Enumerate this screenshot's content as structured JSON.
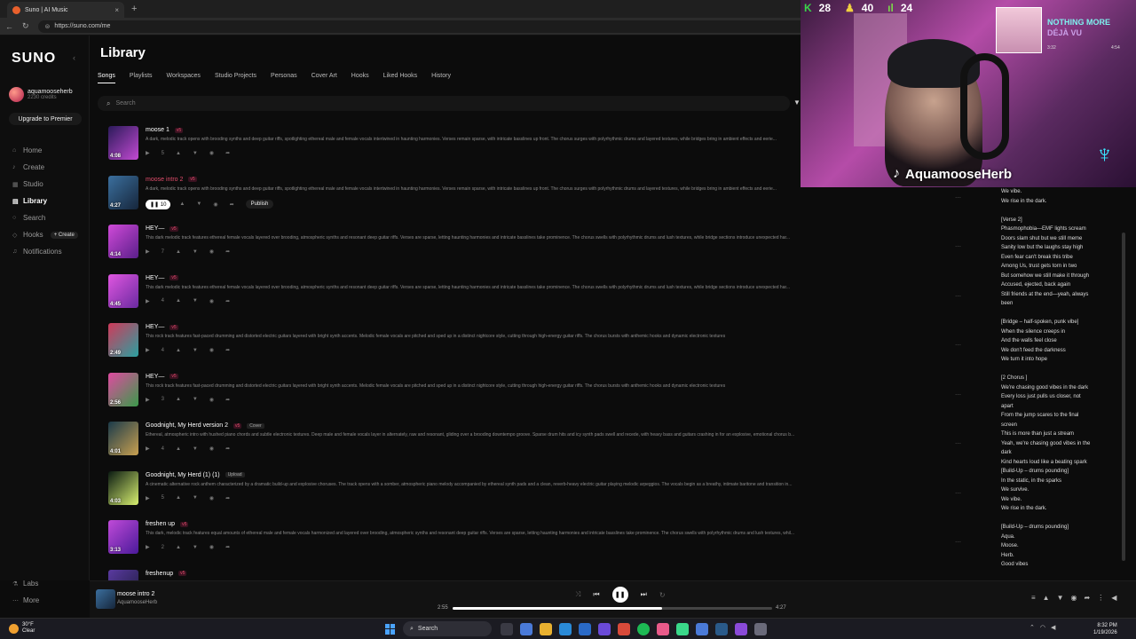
{
  "browser": {
    "tab_title": "Suno | AI Music",
    "tab_close": "×",
    "new_tab": "+",
    "url": "https://suno.com/me"
  },
  "sidebar": {
    "logo": "SUNO",
    "user_name": "aquamooseherb",
    "credits": "2230 credits",
    "upgrade_label": "Upgrade to Premier",
    "items": [
      {
        "label": "Home",
        "icon": "home-icon",
        "glyph": "⌂"
      },
      {
        "label": "Create",
        "icon": "create-icon",
        "glyph": "♪"
      },
      {
        "label": "Studio",
        "icon": "studio-icon",
        "glyph": "▦"
      },
      {
        "label": "Library",
        "icon": "library-icon",
        "glyph": "▤"
      },
      {
        "label": "Search",
        "icon": "search-icon",
        "glyph": "○"
      },
      {
        "label": "Hooks",
        "icon": "hooks-icon",
        "glyph": "◇"
      },
      {
        "label": "Notifications",
        "icon": "bell-icon",
        "glyph": "♫"
      }
    ],
    "hooks_create": "+ Create",
    "labs": "Labs",
    "more": "More"
  },
  "main": {
    "title": "Library",
    "tabs": [
      "Songs",
      "Playlists",
      "Workspaces",
      "Studio Projects",
      "Personas",
      "Cover Art",
      "Hooks",
      "Liked Hooks",
      "History"
    ],
    "search_placeholder": "Search"
  },
  "songs": [
    {
      "title": "moose 1",
      "version": "v5",
      "duration": "4:08",
      "plays": "5",
      "desc": "A dark, melodic track opens with brooding synths and deep guitar riffs, spotlighting ethereal male and female vocals intertwined in haunting harmonies. Verses remain sparse, with intricate basslines up front. The chorus surges with polyrhythmic drums and layered textures, while bridges bring in ambient effects and eerie...",
      "colors": [
        "#2b1a5a",
        "#c24ad2"
      ]
    },
    {
      "title": "moose intro 2",
      "version": "v5",
      "duration": "4:27",
      "plays": "10",
      "desc": "A dark, melodic track opens with brooding synths and deep guitar riffs, spotlighting ethereal male and female vocals intertwined in haunting harmonies. Verses remain sparse, with intricate basslines up front. The chorus surges with polyrhythmic drums and layered textures, while bridges bring in ambient effects and eerie...",
      "colors": [
        "#3b6f9e",
        "#16263b"
      ],
      "playing": true,
      "publish": "Publish"
    },
    {
      "title": "HEY—",
      "version": "v5",
      "duration": "4:14",
      "plays": "7",
      "desc": "This dark melodic track features ethereal female vocals layered over brooding, atmospheric synths and resonant deep guitar riffs. Verses are sparse, letting haunting harmonies and intricate basslines take prominence. The chorus swells with polyrhythmic drums and lush textures, while bridge sections introduce unexpected har...",
      "colors": [
        "#d04ad8",
        "#5a1f8a"
      ]
    },
    {
      "title": "HEY—",
      "version": "v5",
      "duration": "4:45",
      "plays": "4",
      "desc": "This dark melodic track features ethereal female vocals layered over brooding, atmospheric synths and resonant deep guitar riffs. Verses are sparse, letting haunting harmonies and intricate basslines take prominence. The chorus swells with polyrhythmic drums and lush textures, while bridge sections introduce unexpected har...",
      "colors": [
        "#e056e0",
        "#6a2aa0"
      ]
    },
    {
      "title": "HEY—",
      "version": "v5",
      "duration": "2:49",
      "plays": "4",
      "desc": "This rock track features fast-paced drumming and distorted electric guitars layered with bright synth accents. Melodic female vocals are pitched and sped up in a distinct nightcore style, cutting through high-energy guitar riffs. The chorus bursts with anthemic hooks and dynamic electronic textures",
      "colors": [
        "#d03a5a",
        "#2aa0a0"
      ]
    },
    {
      "title": "HEY—",
      "version": "v5",
      "duration": "2:56",
      "plays": "3",
      "desc": "This rock track features fast-paced drumming and distorted electric guitars layered with bright synth accents. Melodic female vocals are pitched and sped up in a distinct nightcore style, cutting through high-energy guitar riffs. The chorus bursts with anthemic hooks and dynamic electronic textures",
      "colors": [
        "#e04aa0",
        "#3a9a4a"
      ]
    },
    {
      "title": "Goodnight, My Herd version 2",
      "version": "v5",
      "tag": "Cover",
      "duration": "4:01",
      "plays": "4",
      "desc": "Ethereal, atmospheric intro with hushed piano chords and subtle electronic textures. Deep male and female vocals layer in alternately, raw and resonant, gliding over a brooding downtempo groove. Sparse drum hits and icy synth pads swell and recede, with heavy bass and guitars crashing in for an explosive, emotional chorus b...",
      "colors": [
        "#1a3a4a",
        "#c8a050"
      ]
    },
    {
      "title": "Goodnight, My Herd (1) (1)",
      "tag": "Upload",
      "duration": "4:03",
      "plays": "5",
      "desc": "A cinematic alternative rock anthem characterized by a dramatic build-up and explosive choruses. The track opens with a somber, atmospheric piano melody accompanied by ethereal synth pads and a clean, reverb-heavy electric guitar playing melodic arpeggios. The vocals begin as a breathy, intimate baritone and transition in...",
      "colors": [
        "#0a1a12",
        "#d8f070"
      ]
    },
    {
      "title": "freshen up",
      "version": "v5",
      "duration": "3:13",
      "plays": "2",
      "desc": "This dark, melodic track features equal amounts of ethereal male and female vocals harmonized and layered over brooding, atmospheric synths and resonant deep guitar riffs. Verses are sparse, letting haunting harmonies and intricate basslines take prominence. The chorus swells with polyrhythmic drums and lush textures, whil...",
      "colors": [
        "#c04ad8",
        "#4a1a9a"
      ]
    },
    {
      "title": "freshenup",
      "version": "v5",
      "duration": "3:10",
      "plays": "2",
      "desc": "",
      "colors": [
        "#5a3aa0",
        "#1a1a3a"
      ]
    }
  ],
  "lyrics": [
    "We vibe.",
    "We rise in the dark.",
    "",
    "[Verse 2]",
    "Phasmophobia—EMF lights scream",
    "Doors slam shut but we still meme",
    "Sanity low but the laughs stay high",
    "Even fear can't break this tribe",
    "Among Us, trust gets torn in two",
    "But somehow we still make it through",
    "Accused, ejected, back again",
    "Still friends at the end—yeah, always",
    "been",
    "",
    "[Bridge – half-spoken, punk vibe]",
    "When the silence creeps in",
    "And the walls feel close",
    "We don't feed the darkness",
    "We turn it into hope",
    "",
    "[2 Chorus ]",
    "We're chasing good vibes in the dark",
    "Every loss just pulls us closer, not",
    "apart",
    "From the jump scares to the final",
    "screen",
    "This is more than just a stream",
    "Yeah, we're chasing good vibes in the",
    "dark",
    "Kind hearts loud like a beating spark",
    "[Build-Up – drums pounding]",
    "In the static, in the sparks",
    "We survive.",
    "We vibe.",
    "We rise in the dark.",
    "",
    "[Build-Up – drums pounding]",
    "Aqua.",
    "Moose.",
    "Herb.",
    "Good vibes"
  ],
  "stream": {
    "stat1": "28",
    "stat2": "40",
    "stat3": "24",
    "np_label": "NOTHING MORE",
    "np_song": "DÉJÀ VU",
    "np_cur": "3:32",
    "np_tot": "4:54",
    "handle": "AquamooseHerb"
  },
  "player": {
    "title": "moose intro 2",
    "artist": "AquamooseHerb",
    "current": "2:55",
    "total": "4:27",
    "progress": 0.655
  },
  "taskbar": {
    "temp": "30°F",
    "cond": "Clear",
    "search": "Search",
    "time": "8:32 PM",
    "date": "1/19/2026"
  }
}
